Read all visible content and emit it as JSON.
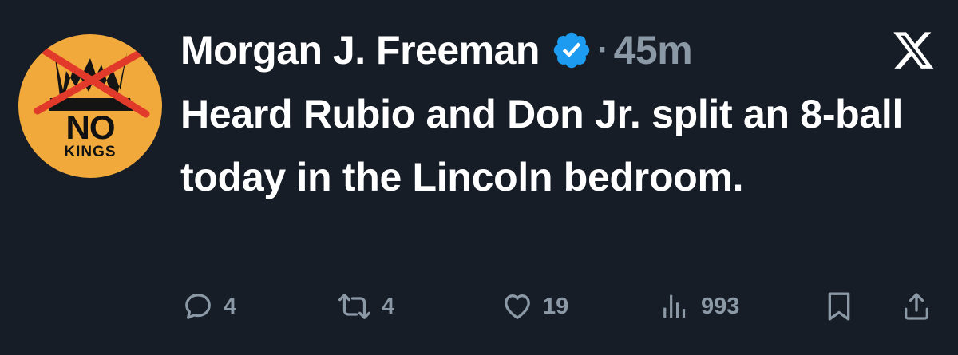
{
  "author": {
    "display_name": "Morgan J. Freeman",
    "time_separator": "·",
    "time_ago": "45m",
    "avatar": {
      "line1": "NO",
      "line2": "KINGS",
      "background": "#f2a93b"
    },
    "verified_color": "#1d9bf0"
  },
  "tweet": {
    "text": "Heard Rubio and Don Jr. split an 8-ball today in the Lincoln bedroom."
  },
  "actions": {
    "replies": "4",
    "reposts": "4",
    "likes": "19",
    "views": "993",
    "icons": [
      "reply-icon",
      "repost-icon",
      "like-icon",
      "views-icon",
      "bookmark-icon",
      "share-icon"
    ]
  },
  "theme": {
    "background": "#161d27",
    "text": "#ffffff",
    "muted": "#8b98a5"
  }
}
